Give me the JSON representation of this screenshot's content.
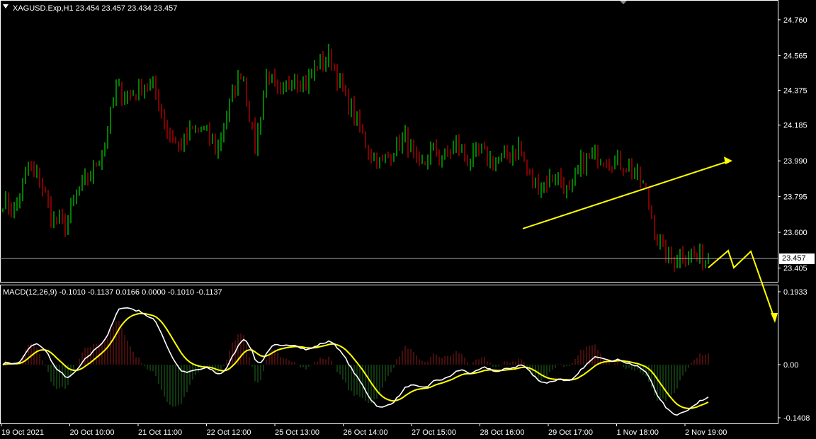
{
  "header": {
    "symbol_line": "XAGUSD.Exp,H1  23.454 23.457 23.434 23.457"
  },
  "current_price": "23.457",
  "macd_header": "MACD(12,26,9) -0.1010 -0.1137 0.0166 0.0000 -0.1010 -0.1137",
  "colors": {
    "background": "#000000",
    "bull": "#00ff00",
    "bear": "#ff0000",
    "macd_line": "#ffffff",
    "signal_line": "#ffff00",
    "hist_pos": "#8b1a1a",
    "hist_neg": "#1f6b1f",
    "annotation": "#ffff00",
    "axis": "#ffffff"
  },
  "chart_data": [
    {
      "type": "candlestick",
      "title": "XAGUSD.Exp,H1",
      "ylim": [
        23.33,
        24.86
      ],
      "y_ticks": [
        "24.760",
        "24.565",
        "24.375",
        "24.185",
        "23.990",
        "23.795",
        "23.600",
        "23.405"
      ],
      "y_tick_values": [
        24.76,
        24.565,
        24.375,
        24.185,
        23.99,
        23.795,
        23.6,
        23.405
      ],
      "x_ticks": [
        "19 Oct 2021",
        "20 Oct 10:00",
        "21 Oct 11:00",
        "22 Oct 12:00",
        "25 Oct 13:00",
        "26 Oct 14:00",
        "27 Oct 15:00",
        "28 Oct 16:00",
        "29 Oct 17:00",
        "1 Nov 18:00",
        "2 Nov 19:00"
      ],
      "bar_period": "H1",
      "close_anchors": [
        23.78,
        23.72,
        23.96,
        23.88,
        23.66,
        23.64,
        23.82,
        23.92,
        24.06,
        24.38,
        24.34,
        24.4,
        24.38,
        24.16,
        24.06,
        24.15,
        24.16,
        24.05,
        24.3,
        24.5,
        24.05,
        24.48,
        24.32,
        24.47,
        24.4,
        24.52,
        24.56,
        24.36,
        24.22,
        24.05,
        23.97,
        24.06,
        24.12,
        23.92,
        24.05,
        24.0,
        24.08,
        23.98,
        24.04,
        23.98,
        24.02,
        24.07,
        23.86,
        23.87,
        23.91,
        23.8,
        23.99,
        24.02,
        24.0,
        23.98,
        23.94,
        23.83,
        23.55,
        23.44,
        23.5,
        23.46,
        23.457
      ],
      "last_price": 23.457
    },
    {
      "type": "macd",
      "title": "MACD(12,26,9)",
      "params": [
        12,
        26,
        9
      ],
      "values": {
        "main": -0.101,
        "signal": -0.1137,
        "hist": 0.0166,
        "zero": 0.0
      },
      "ylim": [
        -0.1408,
        0.1933
      ],
      "y_ticks": [
        "0.1933",
        "0.00",
        "-0.1408"
      ],
      "y_tick_values": [
        0.1933,
        0.0,
        -0.1408
      ]
    }
  ],
  "annotations": {
    "trendline": {
      "color": "#ffff00",
      "from_price": 23.62,
      "to_price": 23.99,
      "from_label": "28 Oct 16:00",
      "to_label": "1 Nov 18:00"
    },
    "zigzag_arrow": {
      "color": "#ffff00",
      "description": "up-down-up then down projection"
    }
  }
}
